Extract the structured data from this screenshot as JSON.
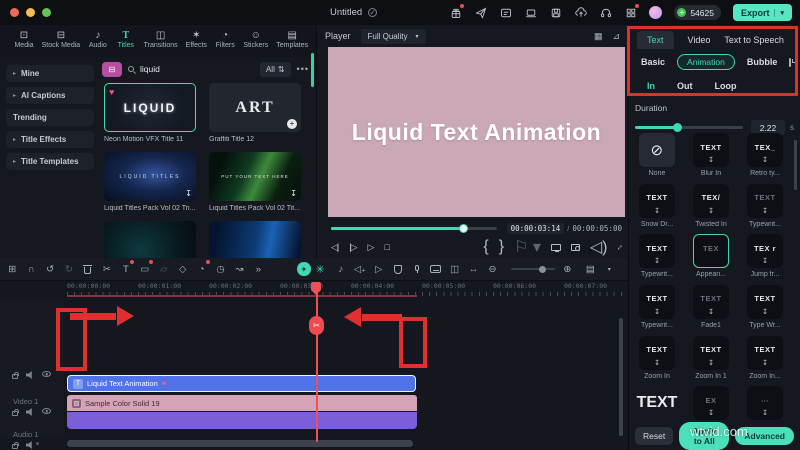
{
  "titlebar": {
    "title": "Untitled",
    "coins": "54625",
    "export_label": "Export",
    "icons": [
      "gift-icon",
      "share-icon",
      "tasks-icon",
      "device-icon",
      "save-icon",
      "upload-icon",
      "support-icon",
      "apps-icon"
    ]
  },
  "media": {
    "tabs": [
      {
        "label": "Media"
      },
      {
        "label": "Stock Media"
      },
      {
        "label": "Audio"
      },
      {
        "label": "Titles",
        "active": true
      },
      {
        "label": "Transitions"
      },
      {
        "label": "Effects"
      },
      {
        "label": "Filters"
      },
      {
        "label": "Stickers"
      },
      {
        "label": "Templates"
      }
    ],
    "sidebar": [
      {
        "label": "Mine",
        "chevron": "▸"
      },
      {
        "label": "AI Captions",
        "chevron": "▸"
      },
      {
        "label": "Trending",
        "chevron": ""
      },
      {
        "label": "Title Effects",
        "chevron": "▸"
      },
      {
        "label": "Title Templates",
        "chevron": "▸"
      }
    ],
    "search": {
      "value": "liquid",
      "filter_label": "All",
      "more_label": "•••"
    },
    "cards": [
      {
        "name": "Neon Motion VFX Title 11",
        "thumb": "LIQUID"
      },
      {
        "name": "Graffiti Title 12",
        "thumb": "ART"
      },
      {
        "name": "Liquid Titles Pack Vol 02 Tri...",
        "thumb": "LIQUID TITLES"
      },
      {
        "name": "Liquid Titles Pack Vol 02 Tit...",
        "thumb": "PUT YOUR TEXT HERE"
      }
    ]
  },
  "player": {
    "label": "Player",
    "quality": "Full Quality",
    "preview_text": "Liquid Text Animation",
    "current_time": "00:00:03:14",
    "separator": "/",
    "total_time": "00:00:05:00",
    "progress_pct": 68
  },
  "props": {
    "tabs": [
      {
        "label": "Text",
        "active": true
      },
      {
        "label": "Video"
      },
      {
        "label": "Text to Speech"
      }
    ],
    "subtabs": [
      {
        "label": "Basic"
      },
      {
        "label": "Animation",
        "active": true
      },
      {
        "label": "Bubble"
      }
    ],
    "phases": [
      {
        "label": "In",
        "active": true
      },
      {
        "label": "Out"
      },
      {
        "label": "Loop"
      }
    ],
    "duration": {
      "label": "Duration",
      "value": "2.22",
      "unit": "s"
    },
    "presets": [
      {
        "name": "None",
        "glyph": "⊘"
      },
      {
        "name": "Blur In",
        "glyph": "TEXT"
      },
      {
        "name": "Retro ty...",
        "glyph": "TEX_"
      },
      {
        "name": "Snow Dr...",
        "glyph": "TEXT"
      },
      {
        "name": "Twisted In",
        "glyph": "TEX/"
      },
      {
        "name": "Typewrit...",
        "glyph": "TEXT"
      },
      {
        "name": "Typewrit...",
        "glyph": "TEXT"
      },
      {
        "name": "Appeari...",
        "glyph": "TEX",
        "selected": true
      },
      {
        "name": "Jump fr...",
        "glyph": "TEX r"
      },
      {
        "name": "Typewrit...",
        "glyph": "TEXT"
      },
      {
        "name": "Fade1",
        "glyph": "TEXT"
      },
      {
        "name": "Type Wr...",
        "glyph": "TEXT"
      },
      {
        "name": "Zoom In",
        "glyph": "TEXT"
      },
      {
        "name": "Zoom In 1",
        "glyph": "TEXT"
      },
      {
        "name": "Zoom In...",
        "glyph": "TEXT"
      },
      {
        "name": "",
        "glyph": "TEXT"
      },
      {
        "name": "",
        "glyph": "EX"
      },
      {
        "name": "",
        "glyph": "⋯"
      }
    ],
    "buttons": {
      "reset": "Reset",
      "apply": "Apply to All",
      "advanced": "Advanced"
    }
  },
  "timeline": {
    "ruler": [
      "00:00:00:00",
      "00:00:01:00",
      "00:00:02:00",
      "00:00:03:00",
      "00:00:04:00",
      "00:00:05:00",
      "00:00:06:00",
      "00:00:07:00"
    ],
    "tracks": [
      {
        "name": "Video 1"
      },
      {
        "name": "Audio 1"
      }
    ],
    "clips": [
      {
        "label": "Liquid Text Animation",
        "type": "title"
      },
      {
        "label": "Sample Color Solid 19",
        "type": "color"
      }
    ],
    "toolbar_icons": [
      "toolbox-icon",
      "magnet-icon",
      "undo-icon",
      "redo-icon",
      "delete-icon",
      "split-icon",
      "add-text-icon",
      "crop-icon",
      "mask-icon",
      "keyframe-icon",
      "speed-icon",
      "timer-icon",
      "motion-track-icon",
      "more-icon",
      "ai-copilot-icon",
      "ai-sparkle-icon",
      "audio-tag-icon",
      "audio-export-icon",
      "preview-render-icon",
      "silence-detect-icon",
      "record-voiceover-icon",
      "subtitle-icon",
      "split-screen-icon",
      "fit-timeline-icon",
      "zoom-out-icon",
      "zoom-in-icon",
      "track-manager-icon"
    ]
  },
  "colors": {
    "accent": "#3fd9b6",
    "export_bg": "#57e6c2",
    "annotation_red": "#e12f2f",
    "preview_pink": "#cba8b8",
    "clip_blue": "#5173e8",
    "clip_pink": "#d4a3b6",
    "clip_purple": "#7a5fd8"
  },
  "watermark": "wtvid.com"
}
